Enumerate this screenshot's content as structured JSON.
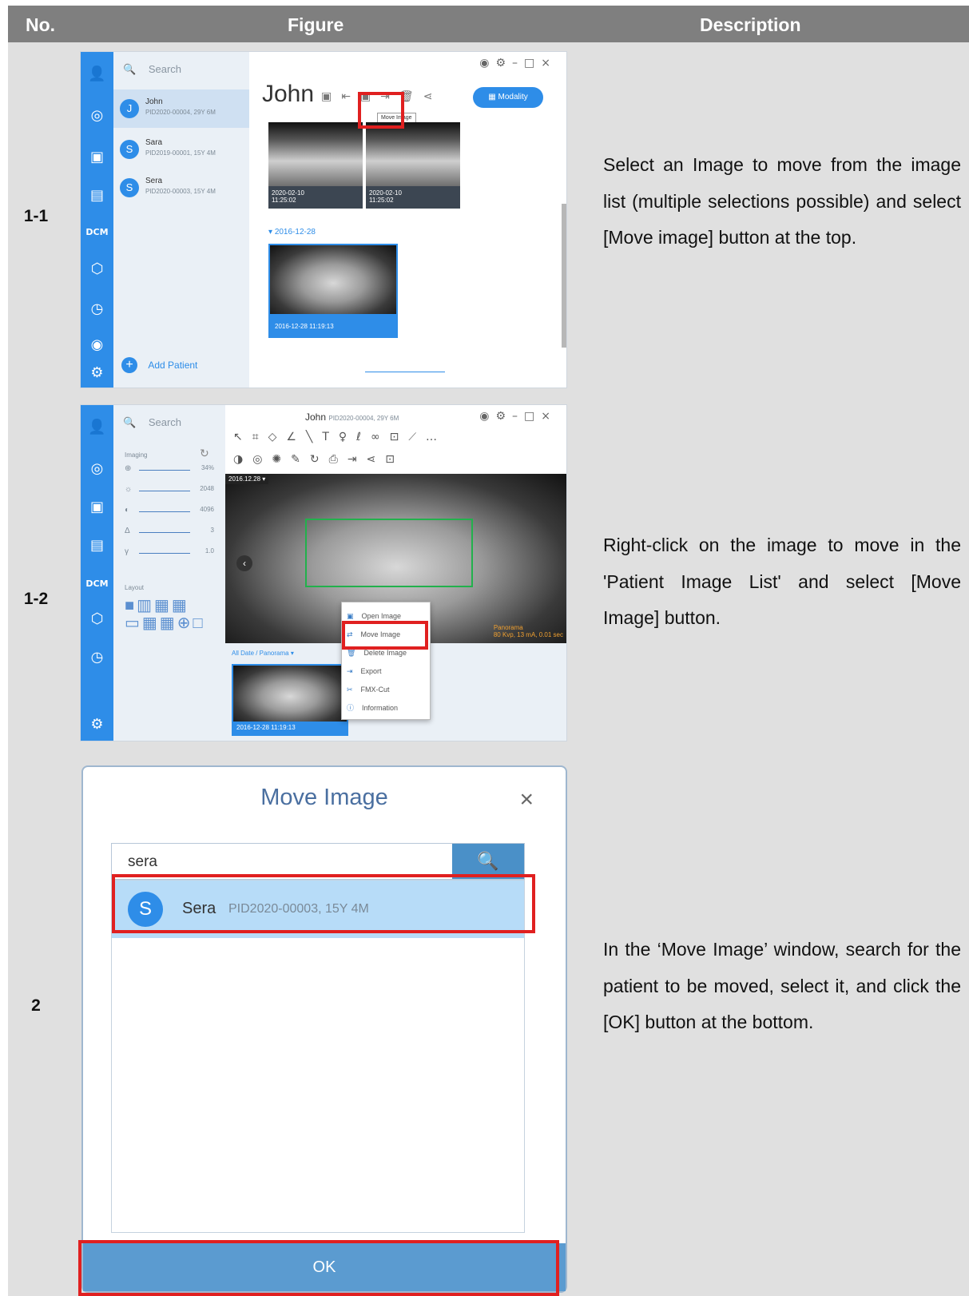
{
  "header": {
    "no": "No.",
    "figure": "Figure",
    "description": "Description"
  },
  "rows": [
    {
      "no": "1-1",
      "description": "Select an Image to move from the image list (multiple selections possible) and select [Move image] button at the top.",
      "figure": {
        "search_placeholder": "Search",
        "patients": [
          {
            "initial": "J",
            "name": "John",
            "info": "PID2020-00004, 29Y 6M"
          },
          {
            "initial": "S",
            "name": "Sara",
            "info": "PID2019-00001, 15Y 4M"
          },
          {
            "initial": "S",
            "name": "Sera",
            "info": "PID2020-00003, 15Y 4M"
          }
        ],
        "add_patient": "Add Patient",
        "patient_title": "John",
        "modality_label": "Modality",
        "tooltip": "Move Image",
        "thumbs": [
          {
            "date": "2020-02-10",
            "time": "11:25:02"
          },
          {
            "date": "2020-02-10",
            "time": "11:25:02"
          }
        ],
        "group_date": "2016-12-28",
        "selected_thumb_label": "2016-12-28 11:19:13"
      }
    },
    {
      "no": "1-2",
      "description": "Right-click on the image to move in the 'Patient Image List' and select [Move Image] button.",
      "figure": {
        "search_placeholder": "Search",
        "title_name": "John",
        "title_info": "PID2020-00004, 29Y 6M",
        "imaging_label": "Imaging",
        "sliders": [
          {
            "icon": "⊕",
            "value": "34%"
          },
          {
            "icon": "☼",
            "value": "2048"
          },
          {
            "icon": "◐",
            "value": "4096"
          },
          {
            "icon": "Δ",
            "value": "3"
          },
          {
            "icon": "γ",
            "value": "1.0"
          }
        ],
        "layout_label": "Layout",
        "image_date_tag": "2016.12.28",
        "panorama_label": "Panorama",
        "exposure_info": "80 Kvp, 13 mA, 0.01 sec",
        "filter_label": "All Date / Panorama",
        "thumb_label": "2016-12-28 11:19:13",
        "context_menu": [
          {
            "icon": "open-image-icon",
            "label": "Open Image"
          },
          {
            "icon": "move-image-icon",
            "label": "Move Image"
          },
          {
            "icon": "delete-image-icon",
            "label": "Delete Image"
          },
          {
            "icon": "export-icon",
            "label": "Export"
          },
          {
            "icon": "fmx-cut-icon",
            "label": "FMX-Cut"
          },
          {
            "icon": "information-icon",
            "label": "Information"
          }
        ]
      }
    },
    {
      "no": "2",
      "description": "In the ‘Move Image’ window, search for the patient to be moved, select it, and click the [OK] button at the bottom.",
      "figure": {
        "dialog_title": "Move Image",
        "search_value": "sera",
        "result": {
          "initial": "S",
          "name": "Sera",
          "info": "PID2020-00003, 15Y 4M"
        },
        "ok_label": "OK"
      }
    }
  ],
  "colors": {
    "accent": "#2e8de8",
    "highlight": "#e02020",
    "header_bg": "#7f7f7f",
    "row_bg": "#e0e0e0"
  }
}
